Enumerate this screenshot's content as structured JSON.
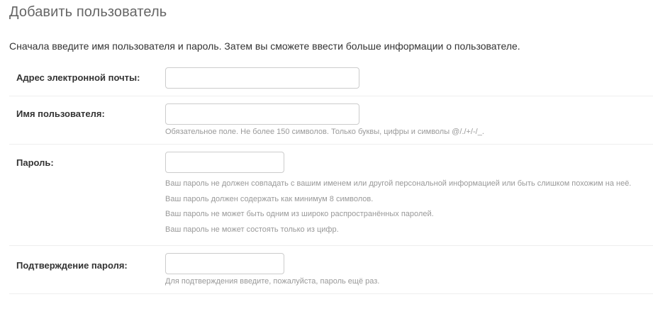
{
  "page": {
    "title": "Добавить пользователь",
    "intro": "Сначала введите имя пользователя и пароль. Затем вы сможете ввести больше информации о пользователе."
  },
  "form": {
    "email": {
      "label": "Адрес электронной почты:",
      "value": "",
      "placeholder": ""
    },
    "username": {
      "label": "Имя пользователя:",
      "value": "",
      "placeholder": "",
      "help": "Обязательное поле. Не более 150 символов. Только буквы, цифры и символы @/./+/-/_."
    },
    "password": {
      "label": "Пароль:",
      "value": "",
      "placeholder": "",
      "help": [
        "Ваш пароль не должен совпадать с вашим именем или другой персональной информацией или быть слишком похожим на неё.",
        "Ваш пароль должен содержать как минимум 8 символов.",
        "Ваш пароль не может быть одним из широко распространённых паролей.",
        "Ваш пароль не может состоять только из цифр."
      ]
    },
    "password_confirm": {
      "label": "Подтверждение пароля:",
      "value": "",
      "placeholder": "",
      "help": "Для подтверждения введите, пожалуйста, пароль ещё раз."
    }
  }
}
